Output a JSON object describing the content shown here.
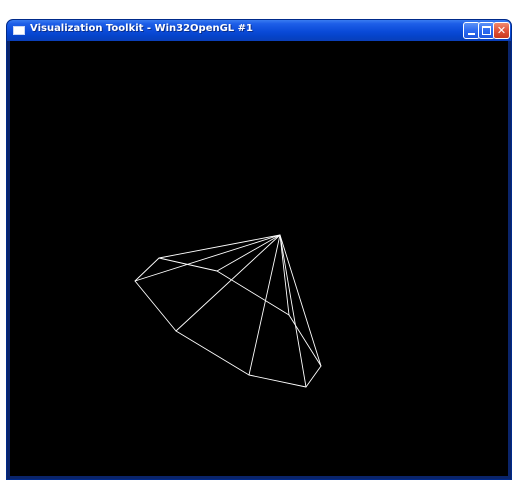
{
  "window": {
    "title": "Visualization Toolkit - Win32OpenGL #1",
    "icon": "window-app-icon",
    "buttons": {
      "minimize": "minimize-icon",
      "maximize": "maximize-icon",
      "close": "close-icon"
    }
  },
  "render": {
    "background": "#000000",
    "wireframe_color": "#ffffff",
    "object": "cone-wireframe"
  },
  "colors": {
    "titlebar": "#0a4ad8",
    "close_button": "#e0533a"
  }
}
